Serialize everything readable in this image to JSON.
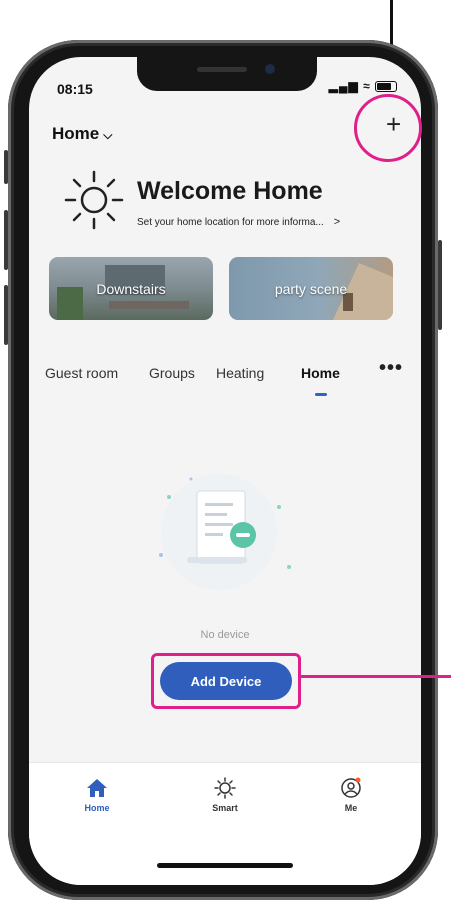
{
  "status": {
    "time": "08:15"
  },
  "header": {
    "home_selector": "Home",
    "add_button": "+"
  },
  "welcome": {
    "title": "Welcome Home",
    "subtitle": "Set your home location for more informa...",
    "arrow": ">"
  },
  "scenes": [
    {
      "label": "Downstairs"
    },
    {
      "label": "party scene"
    }
  ],
  "room_tabs": [
    {
      "label": "Guest room",
      "active": false
    },
    {
      "label": "Groups",
      "active": false
    },
    {
      "label": "Heating",
      "active": false
    },
    {
      "label": "Home",
      "active": true
    }
  ],
  "more_label": "•••",
  "empty_state": {
    "message": "No device",
    "button": "Add Device"
  },
  "tabbar": [
    {
      "label": "Home",
      "icon": "house-icon",
      "active": true
    },
    {
      "label": "Smart",
      "icon": "sun-icon",
      "active": false
    },
    {
      "label": "Me",
      "icon": "profile-icon",
      "active": false
    }
  ],
  "colors": {
    "accent": "#2f5ebd",
    "annotation": "#e0208a"
  }
}
